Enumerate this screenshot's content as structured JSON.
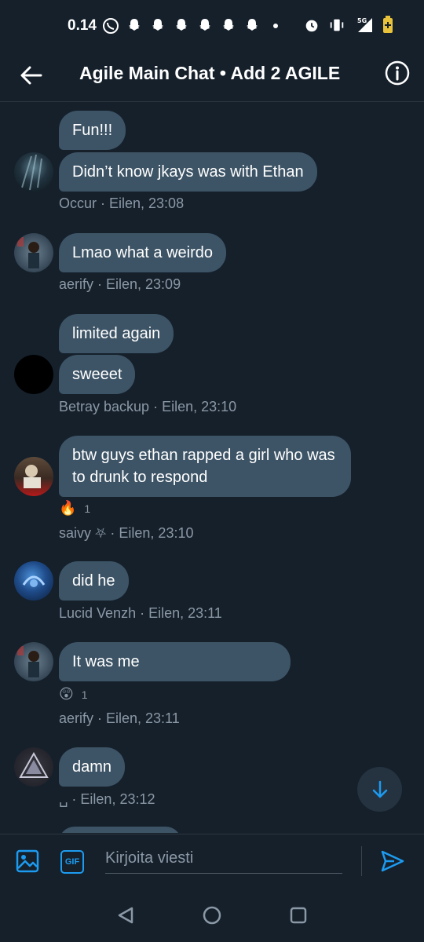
{
  "status_bar": {
    "time": "0.14",
    "network": "5G"
  },
  "header": {
    "title": "Agile Main Chat • Add 2 AGILE"
  },
  "messages": [
    {
      "text": "Fun!!!"
    },
    {
      "text": "Didn’t know jkays was with Ethan",
      "meta": "Occur · Eilen, 23:08"
    },
    {
      "text": "Lmao what a weirdo",
      "meta": "aerify · Eilen, 23:09"
    },
    {
      "text": "limited again"
    },
    {
      "text": "sweeet",
      "meta": "Betray backup · Eilen, 23:10"
    },
    {
      "text": "btw guys ethan rapped a girl who was to drunk to respond",
      "reaction_emoji": "🔥",
      "reaction_count": "1",
      "meta": "saivy ⛧ · Eilen, 23:10"
    },
    {
      "text": "did he",
      "meta": "Lucid Venzh · Eilen, 23:11"
    },
    {
      "text": "It was me",
      "reaction_emoji": "😲",
      "reaction_count": "1",
      "meta": "aerify · Eilen, 23:11"
    },
    {
      "text": "damn",
      "meta": "␣ · Eilen, 23:12"
    }
  ],
  "composer": {
    "placeholder": "Kirjoita viesti",
    "gif_label": "GIF"
  },
  "colors": {
    "background": "#15202b",
    "bubble": "#3d5466",
    "accent": "#1d9bf0",
    "meta_text": "#8b98a5"
  }
}
